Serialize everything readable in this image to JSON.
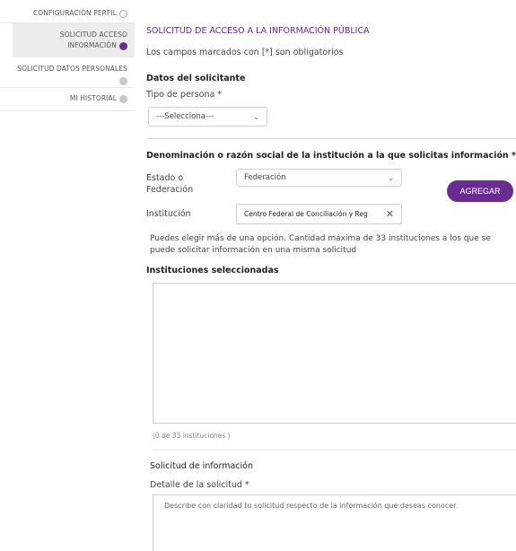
{
  "sidebar": {
    "items": [
      {
        "label": "CONFIGURACIÓN PERFIL",
        "icon": "user-outline-icon"
      },
      {
        "label_line1": "SOLICITUD ACCESO",
        "label_line2": "INFORMACIÓN",
        "icon": "active-dot-icon"
      },
      {
        "label_line1": "SOLICITUD DATOS PERSONALES",
        "icon": "grey-dot-icon"
      },
      {
        "label": "MI HISTORIAL",
        "icon": "grey-dot-icon"
      }
    ]
  },
  "main": {
    "title": "SOLICITUD DE ACCESO A LA INFORMACIÓN PÚBLICA",
    "subtitle": "Los campos marcados con [*] son obligatorios",
    "applicant": {
      "heading": "Datos del solicitante",
      "person_type_label": "Tipo de persona *",
      "person_type_value": "---Selecciona---"
    },
    "institution": {
      "heading": "Denominación o razón social de la institución a la que solicitas información *",
      "state_label_line1": "Estado o",
      "state_label_line2": "Federación",
      "state_value": "Federación",
      "add_button": "AGREGAR",
      "institution_label": "Institución",
      "institution_value": "Centro Federal de Conciliación y Reg",
      "help_text": "Puedes elegir más de una opción. Cantidad máxima de 33 instituciones a los que se puede solicitar información en una misma solicitud",
      "selected_heading": "Instituciones seleccionadas",
      "counter": "(0 de 33 instituciones )"
    },
    "request": {
      "heading": "Solicitud de información",
      "detail_label": "Detalle de la solicitud *",
      "detail_placeholder": "Describe con claridad tu solicitud respecto de la información que deseas conocer"
    }
  },
  "colors": {
    "accent": "#6a2c91"
  }
}
